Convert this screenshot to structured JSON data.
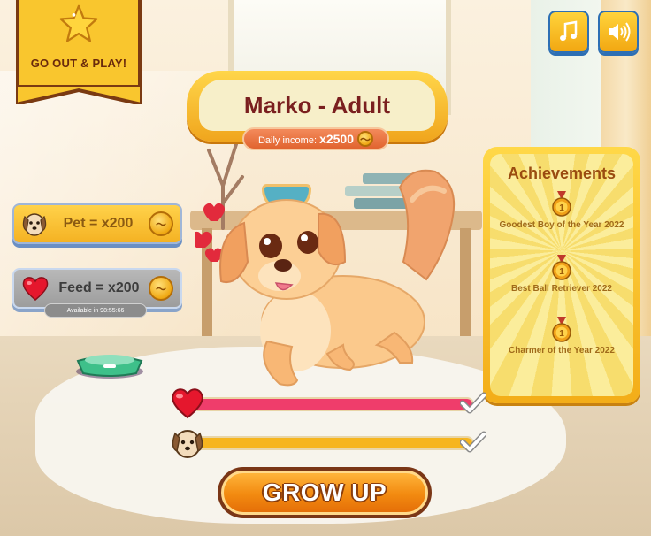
{
  "banner": {
    "label": "GO OUT & PLAY!",
    "icon": "star-icon"
  },
  "top_buttons": {
    "music_icon": "music-note-icon",
    "sound_icon": "speaker-icon"
  },
  "pet_name_plate": {
    "title": "Marko - Adult",
    "income_label": "Daily income:",
    "income_value": "x2500"
  },
  "actions": {
    "pet": {
      "label": "Pet = x200",
      "icon": "dog-face-icon",
      "enabled": true
    },
    "feed": {
      "label": "Feed = x200",
      "icon": "heart-icon",
      "enabled": false,
      "availability": "Available in 98:55:66"
    }
  },
  "achievements": {
    "title": "Achievements",
    "items": [
      {
        "text": "Goodest Boy of the Year 2022",
        "icon": "medal-icon"
      },
      {
        "text": "Best Ball Retriever 2022",
        "icon": "medal-icon"
      },
      {
        "text": "Charmer of the Year 2022",
        "icon": "medal-icon"
      }
    ]
  },
  "stats": [
    {
      "name": "love",
      "icon": "heart-icon",
      "level": 1.0,
      "color": "#ef3d6b",
      "complete": true
    },
    {
      "name": "happiness",
      "icon": "dog-face-icon",
      "level": 1.0,
      "color": "#f6b51e",
      "complete": true
    }
  ],
  "grow_button": {
    "label": "GROW UP"
  },
  "colors": {
    "accent_yellow": "#f9c62e",
    "brown": "#7a3a12",
    "love_bar": "#ef3d6b",
    "happy_bar": "#f6b51e"
  }
}
